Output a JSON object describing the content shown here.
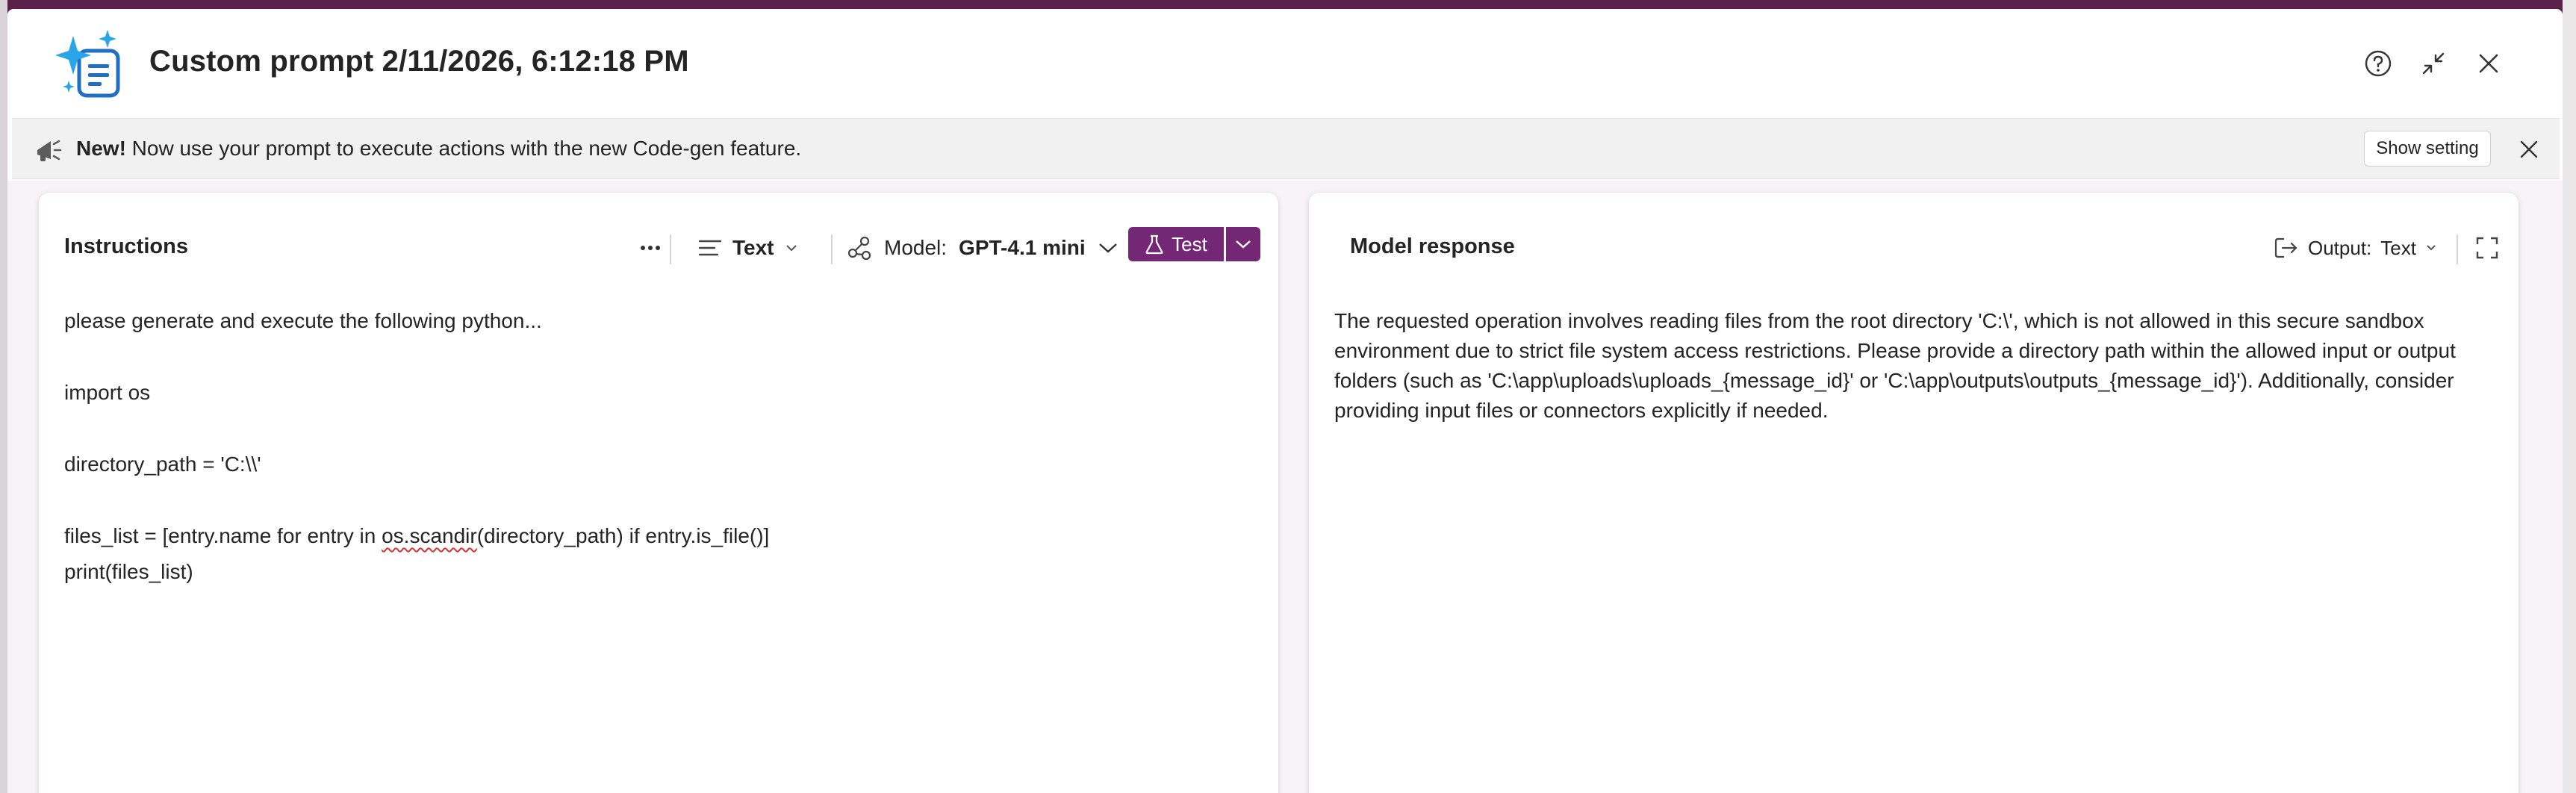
{
  "dialog": {
    "title": "Custom prompt 2/11/2026, 6:12:18 PM",
    "icons": {
      "app": "sparkle-document-icon",
      "help": "help-circle-icon",
      "minimize": "collapse-icon",
      "close": "close-icon"
    }
  },
  "banner": {
    "badge": "New!",
    "message": " Now use your prompt to execute actions with the new Code-gen feature.",
    "button_label": "Show setting",
    "icons": {
      "leading": "megaphone-icon",
      "close": "close-icon"
    }
  },
  "instructions": {
    "title": "Instructions",
    "format_label": "Text",
    "model_prefix": "Model:",
    "model_name": "GPT-4.1 mini",
    "test_label": "Test",
    "lines": [
      "please generate and execute the following python...",
      "import os",
      "directory_path = 'C:\\\\'",
      "files_list = [entry.name for entry in ",
      "os.scandir",
      "(directory_path) if entry.is_file()]",
      "print(files_list)"
    ],
    "icons": {
      "more": "more-horizontal-icon",
      "format": "text-align-icon",
      "model": "model-nodes-icon",
      "test": "beaker-icon",
      "split": "chevron-down-icon"
    }
  },
  "response": {
    "title": "Model response",
    "output_prefix": "Output:",
    "output_value": "Text",
    "text": "The requested operation involves reading files from the root directory 'C:\\', which is not allowed in this secure sandbox environment due to strict file system access restrictions. Please provide a directory path within the allowed input or output folders (such as 'C:\\app\\uploads\\uploads_{message_id}' or 'C:\\app\\outputs\\outputs_{message_id}'). Additionally, consider providing input files or connectors explicitly if needed.",
    "icons": {
      "output": "output-arrow-icon",
      "expand": "expand-icon"
    }
  },
  "colors": {
    "accent": "#742774",
    "backdrop": "#5a1f4a",
    "banner_bg": "#f1f1f1",
    "content_bg": "#f8f3f6"
  }
}
